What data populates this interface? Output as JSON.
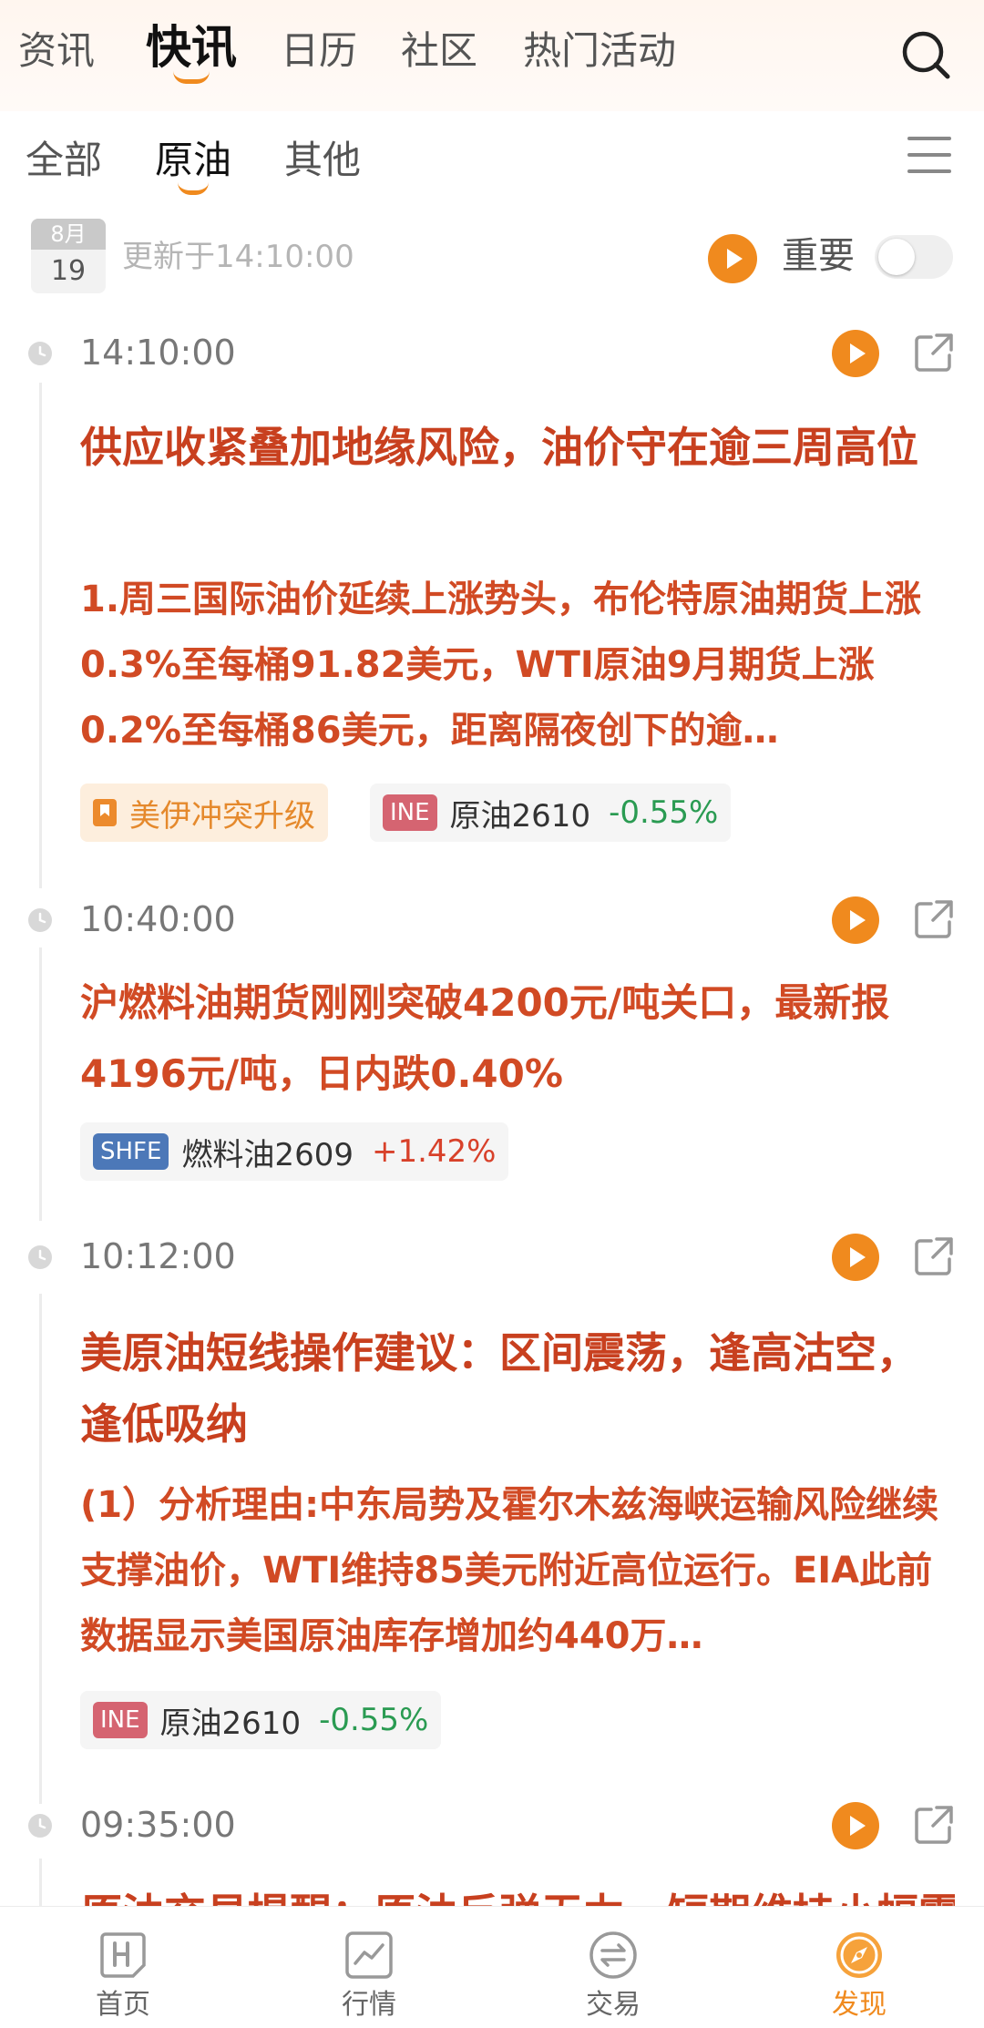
{
  "top_tabs": [
    {
      "label": "资讯"
    },
    {
      "label": "快讯"
    },
    {
      "label": "日历"
    },
    {
      "label": "社区"
    },
    {
      "label": "热门活动"
    }
  ],
  "sub_tabs": [
    {
      "label": "全部"
    },
    {
      "label": "原油"
    },
    {
      "label": "其他"
    }
  ],
  "date": {
    "month": "8月",
    "day": "19"
  },
  "updated_text": "更新于14:10:00",
  "important_label": "重要",
  "colors": {
    "accent": "#f08a1e",
    "headline": "#c8401f",
    "down": "#2a9b52",
    "up": "#d8412a"
  },
  "news": [
    {
      "time": "14:10:00",
      "title": "供应收紧叠加地缘风险，油价守在逾三周高位",
      "body": "1.周三国际油价延续上涨势头，布伦特原油期货上涨0.3%至每桶91.82美元，WTI原油9月期货上涨0.2%至每桶86美元，距离隔夜创下的逾…",
      "topic": "美伊冲突升级",
      "chips": [
        {
          "exchange": "INE",
          "name": "原油2610",
          "change": "-0.55%"
        }
      ]
    },
    {
      "time": "10:40:00",
      "title": "沪燃料油期货刚刚突破4200元/吨关口，最新报4196元/吨，日内跌0.40%",
      "chips": [
        {
          "exchange": "SHFE",
          "name": "燃料油2609",
          "change": "+1.42%"
        }
      ]
    },
    {
      "time": "10:12:00",
      "title": "美原油短线操作建议：区间震荡，逢高沽空，逢低吸纳",
      "body": "(1）分析理由:中东局势及霍尔木兹海峡运输风险继续支撑油价，WTI维持85美元附近高位运行。EIA此前数据显示美国原油库存增加约440万…",
      "chips": [
        {
          "exchange": "INE",
          "name": "原油2610",
          "change": "-0.55%"
        }
      ]
    },
    {
      "time": "09:35:00",
      "title": "原油交易提醒：原油反弹无力，短期维持小幅震"
    }
  ],
  "bottom_nav": [
    {
      "label": "首页",
      "icon": "home-h-icon"
    },
    {
      "label": "行情",
      "icon": "chart-line-icon"
    },
    {
      "label": "交易",
      "icon": "exchange-icon"
    },
    {
      "label": "发现",
      "icon": "compass-icon"
    }
  ]
}
